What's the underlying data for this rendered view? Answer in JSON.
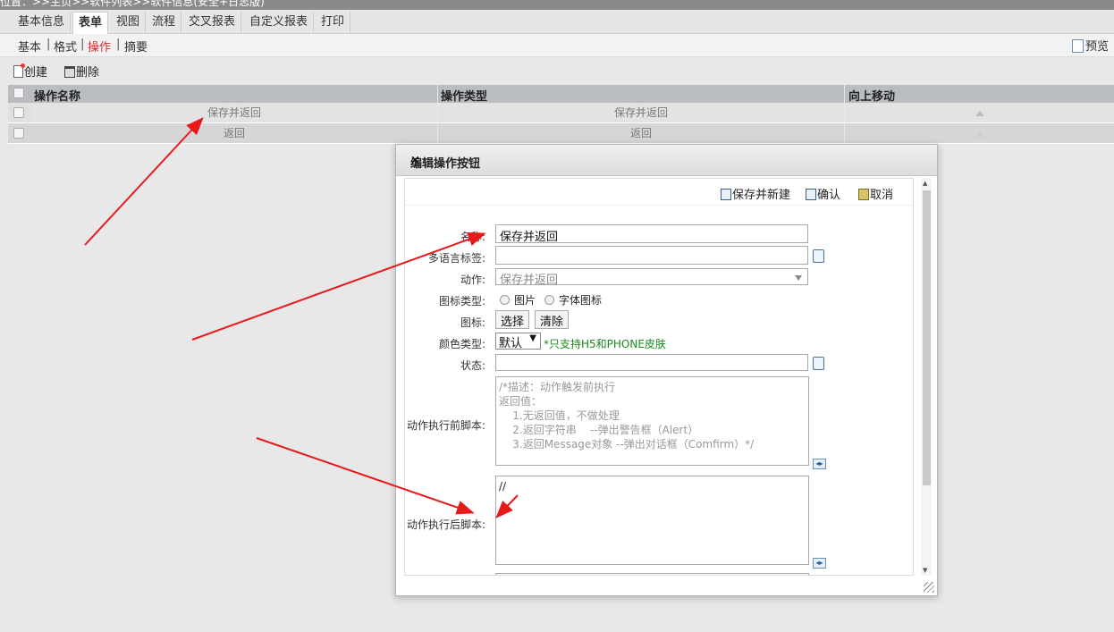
{
  "breadcrumb": "位置：>>主页>>软件列表>>软件信息(安全+日志版)",
  "tabs": [
    "基本信息",
    "表单",
    "视图",
    "流程",
    "交叉报表",
    "自定义报表",
    "打印"
  ],
  "active_tab": "表单",
  "subnav": {
    "items": [
      "基本",
      "格式",
      "操作",
      "摘要"
    ],
    "active": "操作",
    "sep": "|",
    "preview": "预览"
  },
  "toolbar": {
    "create": "创建",
    "delete": "删除"
  },
  "grid": {
    "headers": [
      "操作名称",
      "操作类型",
      "向上移动"
    ],
    "rows": [
      {
        "name": "保存并返回",
        "type": "保存并返回"
      },
      {
        "name": "返回",
        "type": "返回"
      }
    ]
  },
  "dialog": {
    "title": "编辑操作按钮",
    "close": "×",
    "buttons": {
      "save_new": "保存并新建",
      "confirm": "确认",
      "cancel": "取消"
    },
    "labels": {
      "name": "名称:",
      "multilang": "多语言标签:",
      "action": "动作:",
      "icon_type": "图标类型:",
      "icon": "图标:",
      "color_type": "颜色类型:",
      "status": "状态:",
      "before_script": "动作执行前脚本:",
      "after_script": "动作执行后脚本:"
    },
    "values": {
      "name": "保存并返回",
      "action": "保存并返回",
      "color": "默认",
      "after_script": "//"
    },
    "icon_type_options": [
      "图片",
      "字体图标"
    ],
    "icon_buttons": {
      "select": "选择",
      "clear": "清除"
    },
    "color_hint": "*只支持H5和PHONE皮肤",
    "before_placeholder": "/*描述：动作触发前执行\n返回值：\n    1.无返回值，不做处理\n    2.返回字符串    --弹出警告框（Alert）\n    3.返回Message对象 --弹出对话框（Comfirm）*/"
  },
  "colors": {
    "arrow": "#e8191a",
    "hint": "#1b8a1b",
    "active_sub": "#c0392b"
  }
}
